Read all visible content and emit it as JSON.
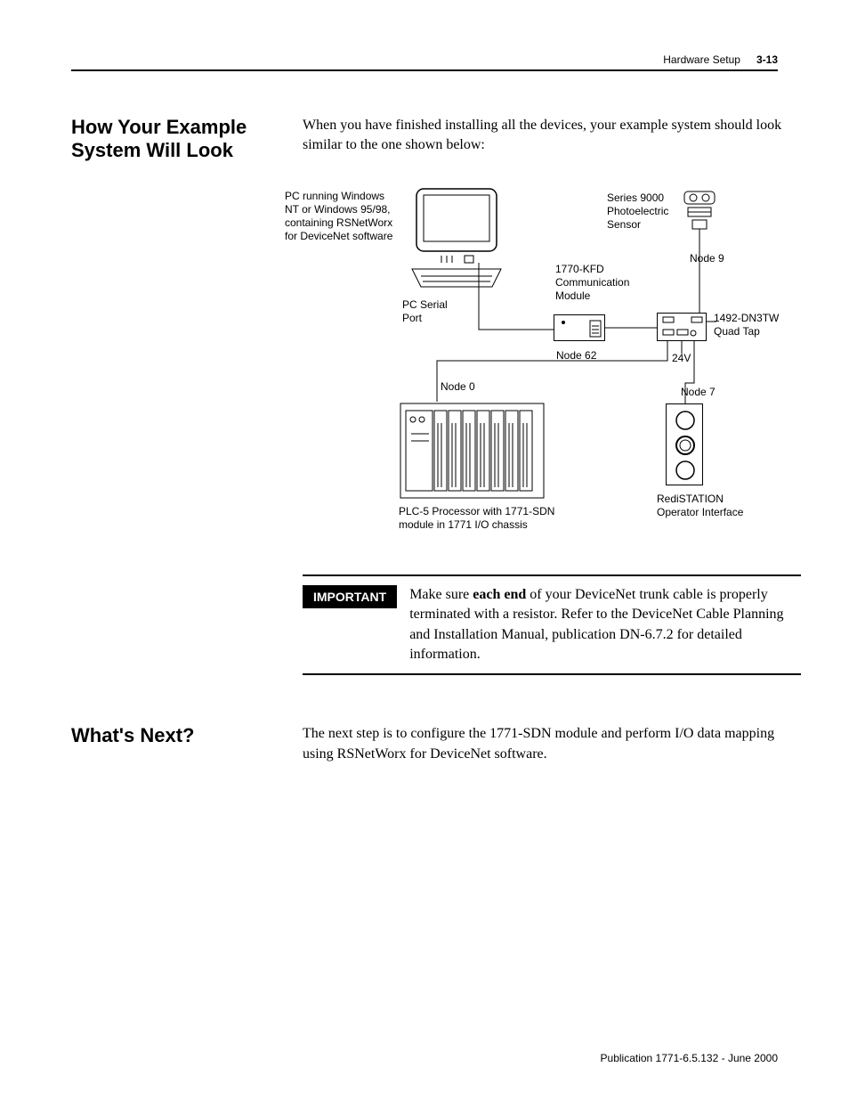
{
  "header": {
    "chapter": "Hardware Setup",
    "page": "3-13"
  },
  "section1": {
    "heading": "How Your Example System Will Look",
    "intro": "When you have finished installing all the devices, your example system should look similar to the one shown below:"
  },
  "diagram": {
    "pc_label": "PC running Windows NT or Windows 95/98, containing RSNetWorx for DeviceNet software",
    "pc_serial": "PC Serial Port",
    "sensor_label": "Series 9000 Photoelectric Sensor",
    "node9": "Node 9",
    "kfd_label": "1770-KFD Communication Module",
    "node62": "Node 62",
    "quadtap_label": "1492-DN3TW Quad Tap",
    "v24": "24V",
    "node0": "Node 0",
    "node7": "Node 7",
    "plc_label": "PLC-5 Processor with 1771-SDN module in 1771 I/O chassis",
    "redi_label": "RediSTATION Operator Interface"
  },
  "important": {
    "tag": "IMPORTANT",
    "text_pre": "Make sure ",
    "text_bold": "each end",
    "text_post": " of your DeviceNet trunk cable is properly terminated with a resistor. Refer to the DeviceNet Cable Planning and Installation Manual, publication DN-6.7.2 for detailed information."
  },
  "section2": {
    "heading": "What's Next?",
    "body": "The next step is to configure the 1771-SDN module and perform I/O data mapping using RSNetWorx for DeviceNet software."
  },
  "footer": "Publication 1771-6.5.132 - June 2000"
}
